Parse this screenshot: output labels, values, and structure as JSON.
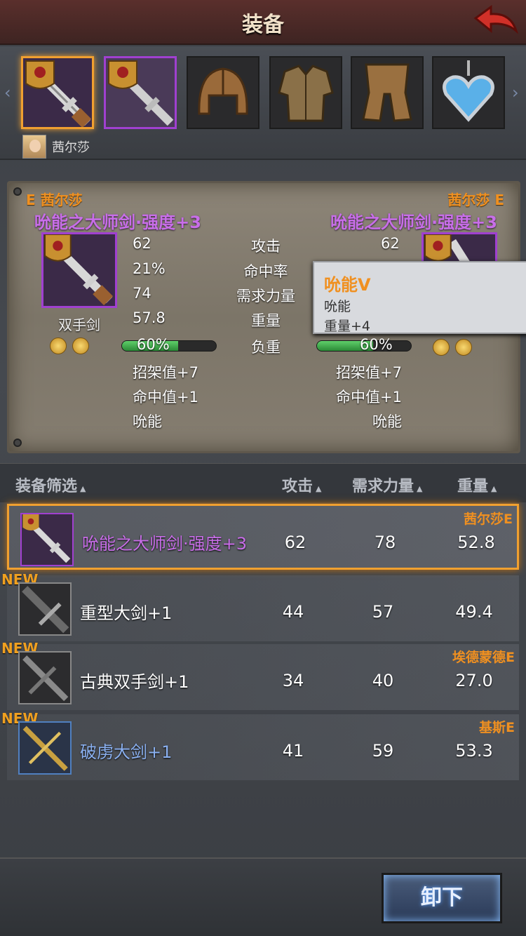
{
  "header": {
    "title": "装备",
    "back_icon": "back-arrow-icon"
  },
  "slots": {
    "items": [
      {
        "icon": "sword-icon",
        "state": "selected"
      },
      {
        "icon": "sword-icon",
        "state": "purple"
      },
      {
        "icon": "helmet-icon",
        "state": "normal"
      },
      {
        "icon": "armor-icon",
        "state": "normal"
      },
      {
        "icon": "boots-icon",
        "state": "normal"
      },
      {
        "icon": "amulet-icon",
        "state": "normal"
      }
    ],
    "owner_name": "茜尔莎"
  },
  "compare": {
    "left": {
      "tag": "E 茜尔莎",
      "name": "吮能之大师剑·强度+3",
      "type": "双手剑",
      "stats": [
        "62",
        "21%",
        "74",
        "57.8"
      ],
      "load": "60%",
      "load_fraction": 0.6,
      "bonuses": [
        "招架值+7",
        "命中值+1",
        "吮能"
      ]
    },
    "right": {
      "tag": "茜尔莎 E",
      "name": "吮能之大师剑·强度+3",
      "stats": [
        "62"
      ],
      "load": "60%",
      "load_fraction": 0.6,
      "bonuses": [
        "招架值+7",
        "命中值+1",
        "吮能"
      ]
    },
    "labels": [
      "攻击",
      "命中率",
      "需求力量",
      "重量",
      "负重"
    ],
    "tooltip": {
      "title": "吮能V",
      "line1": "吮能",
      "line2": "重量+4"
    }
  },
  "list": {
    "headers": {
      "filter": "装备筛选",
      "attack": "攻击",
      "strength": "需求力量",
      "weight": "重量"
    },
    "rows": [
      {
        "name": "吮能之大师剑·强度+3",
        "attack": "62",
        "strength": "78",
        "weight": "52.8",
        "owner": "茜尔莎E",
        "new": "",
        "quality": "purple"
      },
      {
        "name": "重型大剑+1",
        "attack": "44",
        "strength": "57",
        "weight": "49.4",
        "owner": "",
        "new": "NEW",
        "quality": "normal"
      },
      {
        "name": "古典双手剑+1",
        "attack": "34",
        "strength": "40",
        "weight": "27.0",
        "owner": "埃德蒙德E",
        "new": "NEW",
        "quality": "normal"
      },
      {
        "name": "破虏大剑+1",
        "attack": "41",
        "strength": "59",
        "weight": "53.3",
        "owner": "基斯E",
        "new": "NEW",
        "quality": "blue"
      }
    ]
  },
  "footer": {
    "unequip_label": "卸下"
  },
  "colors": {
    "accent_orange": "#f0a030",
    "purple_quality": "#c86ee8",
    "blue_quality": "#8ab0f0",
    "header_red": "#5a2f2c"
  }
}
